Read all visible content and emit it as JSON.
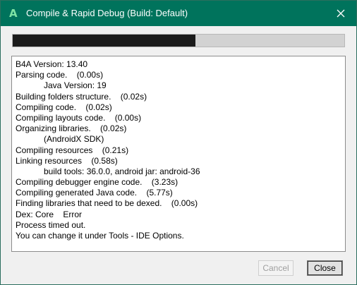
{
  "window": {
    "title": "Compile & Rapid Debug (Build: Default)",
    "app_icon": "A"
  },
  "progress": {
    "value": 0.55
  },
  "log": {
    "lines": [
      "B4A Version: 13.40",
      "Parsing code.    (0.00s)",
      "            Java Version: 19",
      "Building folders structure.    (0.02s)",
      "Compiling code.    (0.02s)",
      "Compiling layouts code.    (0.00s)",
      "Organizing libraries.    (0.02s)",
      "            (AndroidX SDK)",
      "Compiling resources    (0.21s)",
      "Linking resources    (0.58s)",
      "            build tools: 36.0.0, android jar: android-36",
      "Compiling debugger engine code.    (3.23s)",
      "Compiling generated Java code.    (5.77s)",
      "Finding libraries that need to be dexed.    (0.00s)",
      "Dex: Core    Error",
      "Process timed out.",
      "You can change it under Tools - IDE Options."
    ]
  },
  "buttons": {
    "cancel_label": "Cancel",
    "close_label": "Close"
  },
  "colors": {
    "titlebar": "#00735c",
    "progress_fill": "#1b1b1b",
    "progress_track": "#d2d2d2"
  },
  "icons": {
    "app": "b4a-app-icon",
    "close": "close-icon"
  }
}
